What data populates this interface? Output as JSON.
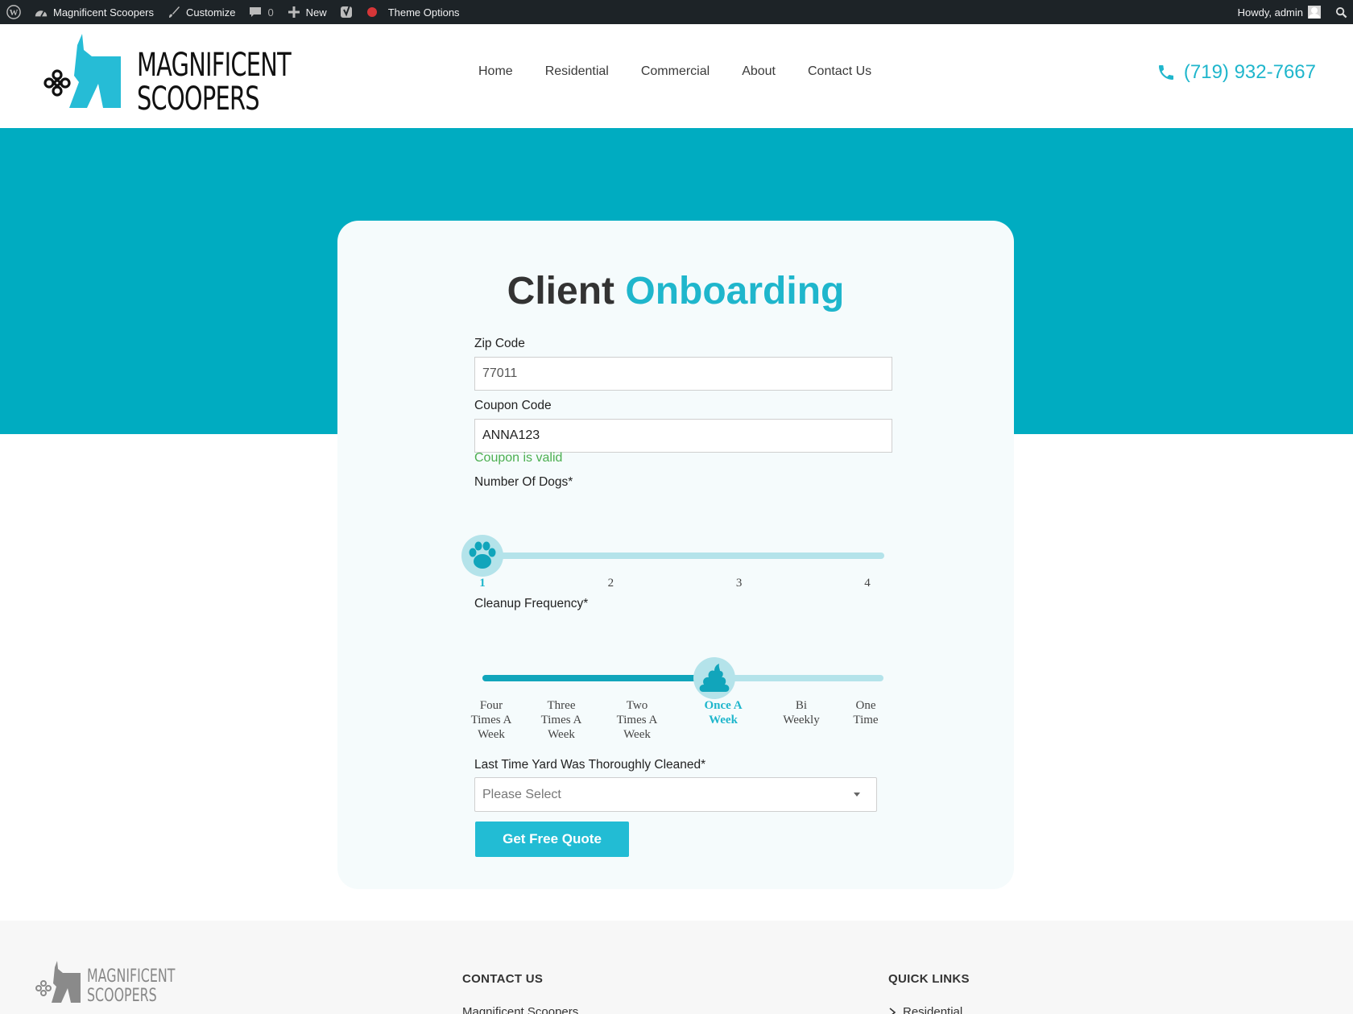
{
  "admin_bar": {
    "site_name": "Magnificent Scoopers",
    "customize": "Customize",
    "comments_count": "0",
    "new_label": "New",
    "theme_options": "Theme Options",
    "greeting": "Howdy, admin"
  },
  "header": {
    "logo_line1": "MAGNIFICENT",
    "logo_line2": "SCOOPERS",
    "nav": [
      "Home",
      "Residential",
      "Commercial",
      "About",
      "Contact Us"
    ],
    "phone": "(719) 932-7667"
  },
  "form": {
    "title_main": "Client",
    "title_accent": "Onboarding",
    "zip_label": "Zip Code",
    "zip_value": "77011",
    "coupon_label": "Coupon Code",
    "coupon_value": "ANNA123",
    "coupon_status": "Coupon is valid",
    "dogs_label": "Number Of Dogs*",
    "dogs_options": [
      "1",
      "2",
      "3",
      "4"
    ],
    "dogs_selected_index": 0,
    "frequency_label": "Cleanup Frequency*",
    "frequency_options": [
      [
        "Four",
        "Times A",
        "Week"
      ],
      [
        "Three",
        "Times A",
        "Week"
      ],
      [
        "Two",
        "Times A",
        "Week"
      ],
      [
        "Once A",
        "Week"
      ],
      [
        "Bi",
        "Weekly"
      ],
      [
        "One",
        "Time"
      ]
    ],
    "frequency_selected_index": 3,
    "last_cleaned_label": "Last Time Yard Was Thoroughly Cleaned*",
    "last_cleaned_placeholder": "Please Select",
    "submit_label": "Get Free Quote"
  },
  "footer": {
    "logo_line1": "MAGNIFICENT",
    "logo_line2": "SCOOPERS",
    "contact_heading": "CONTACT US",
    "contact_line1": "Magnificent Scoopers",
    "links_heading": "QUICK LINKS",
    "links_item1": "Residential"
  },
  "colors": {
    "brand_teal": "#1fb6cc",
    "band": "#00acc1",
    "admin_bar": "#1d2327",
    "valid_green": "#4caf50"
  }
}
